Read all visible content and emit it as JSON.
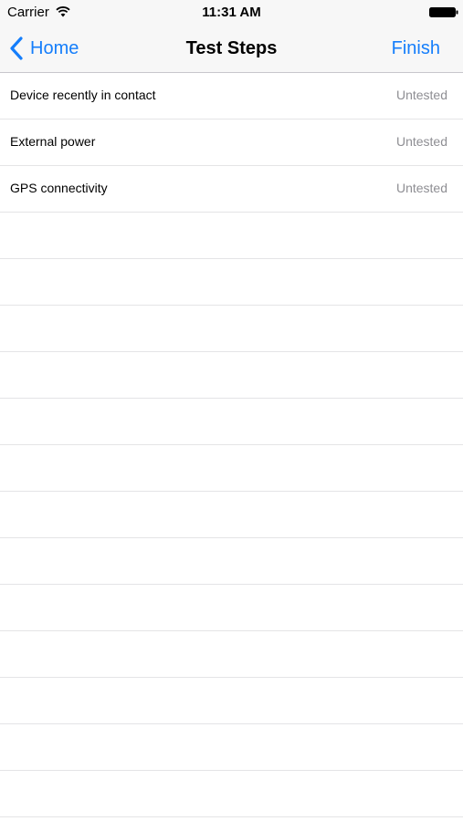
{
  "status_bar": {
    "carrier": "Carrier",
    "time": "11:31 AM",
    "wifi_icon": "wifi-icon",
    "battery_icon": "battery-icon"
  },
  "nav": {
    "back_label": "Home",
    "back_icon": "chevron-left-icon",
    "title": "Test Steps",
    "finish_label": "Finish"
  },
  "colors": {
    "accent": "#157efb",
    "status_text": "#8e8e93",
    "separator": "#e4e4e6",
    "bar_background": "#f7f7f7"
  },
  "test_steps": [
    {
      "label": "Device recently in contact",
      "status": "Untested"
    },
    {
      "label": "External power",
      "status": "Untested"
    },
    {
      "label": "GPS connectivity",
      "status": "Untested"
    }
  ]
}
